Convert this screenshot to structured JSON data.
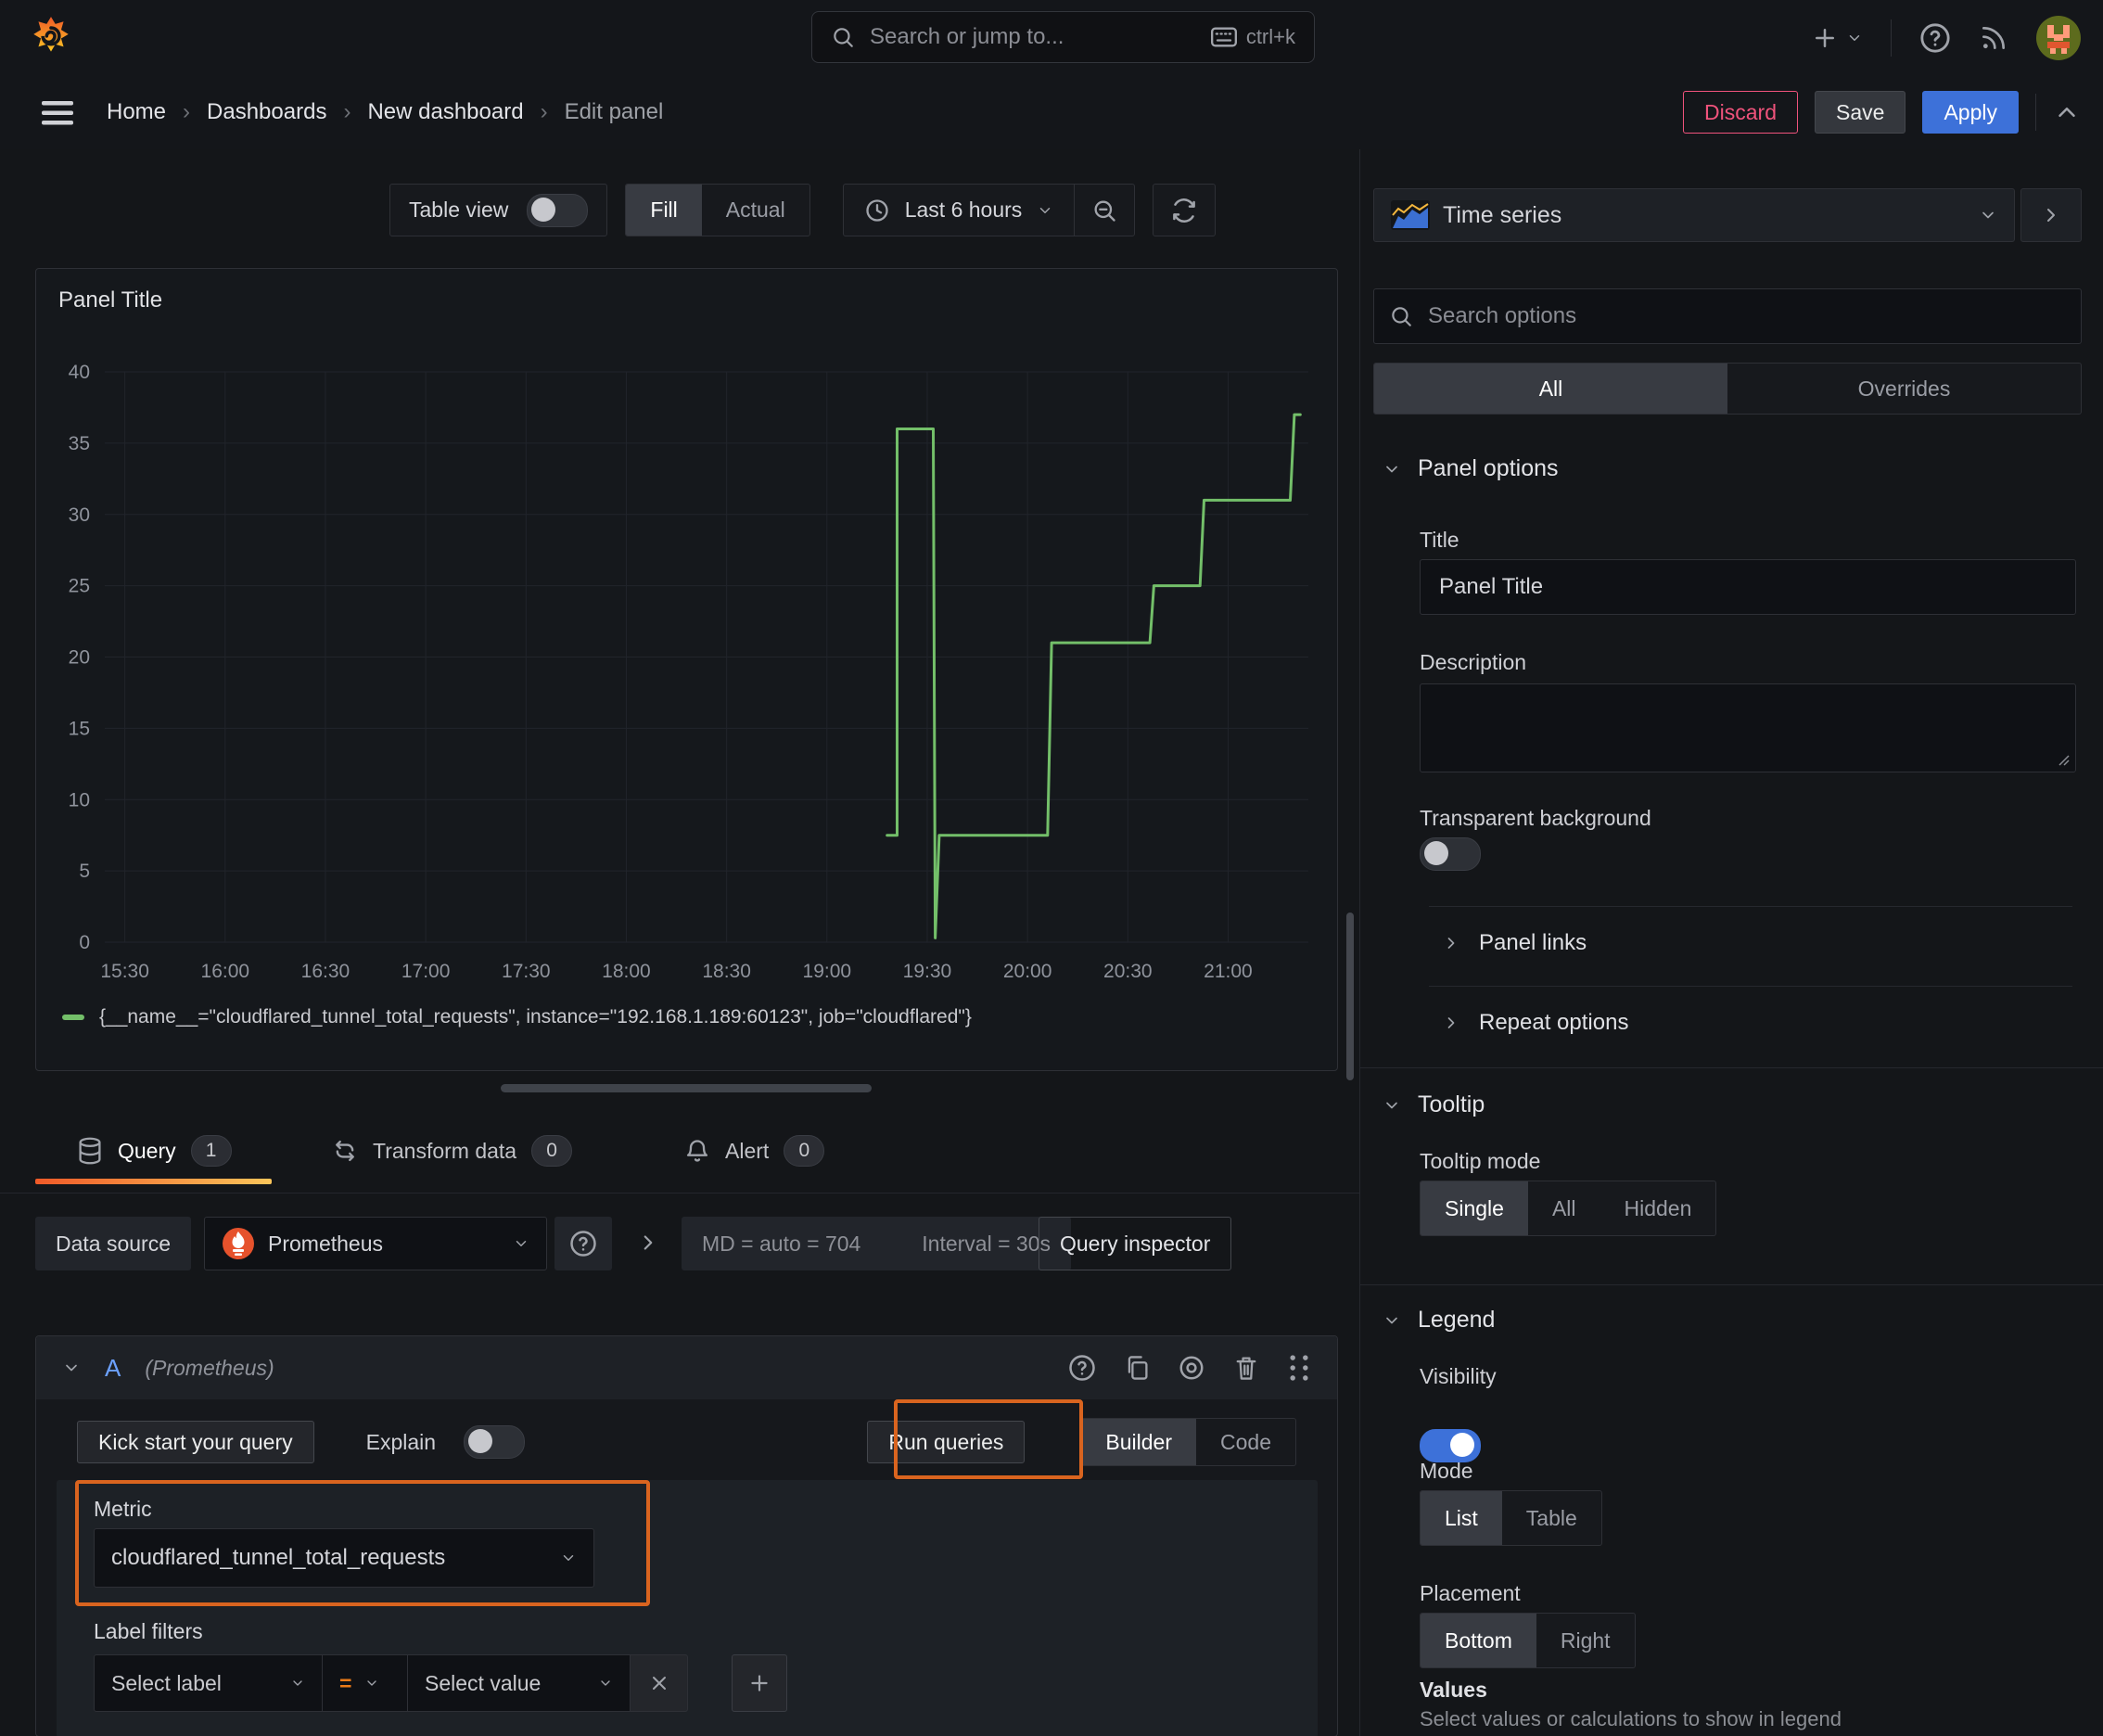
{
  "topbar": {
    "search_placeholder": "Search or jump to...",
    "search_shortcut": "ctrl+k"
  },
  "breadcrumb": {
    "items": [
      "Home",
      "Dashboards",
      "New dashboard",
      "Edit panel"
    ],
    "separator": "›",
    "actions": {
      "discard": "Discard",
      "save": "Save",
      "apply": "Apply"
    }
  },
  "toolbar": {
    "table_view_label": "Table view",
    "fill_label": "Fill",
    "actual_label": "Actual",
    "time_range_label": "Last 6 hours"
  },
  "panel": {
    "title": "Panel Title"
  },
  "chart_data": {
    "type": "line",
    "render": "step",
    "title": "Panel Title",
    "series": [
      {
        "name": "{__name__=\"cloudflared_tunnel_total_requests\", instance=\"192.168.1.189:60123\", job=\"cloudflared\"}",
        "color": "#73bf69"
      }
    ],
    "series_label": "{__name__=\"cloudflared_tunnel_total_requests\", instance=\"192.168.1.189:60123\", job=\"cloudflared\"}",
    "color": "#73bf69",
    "xlabel": "",
    "ylabel": "",
    "ylim": [
      0,
      40
    ],
    "y_ticks": [
      0,
      5,
      10,
      15,
      20,
      25,
      30,
      35,
      40
    ],
    "x_ticks": [
      "15:30",
      "16:00",
      "16:30",
      "17:00",
      "17:30",
      "18:00",
      "18:30",
      "19:00",
      "19:30",
      "20:00",
      "20:30",
      "21:00"
    ],
    "x_tick_hours": [
      15.5,
      16.0,
      16.5,
      17.0,
      17.5,
      18.0,
      18.5,
      19.0,
      19.5,
      20.0,
      20.5,
      21.0
    ],
    "x_range_hours": [
      15.4,
      21.4
    ],
    "grid": true,
    "legend_position": "bottom",
    "points": [
      [
        19.3,
        7.5
      ],
      [
        19.35,
        7.5
      ],
      [
        19.35,
        36
      ],
      [
        19.53,
        36
      ],
      [
        19.54,
        0.3
      ],
      [
        19.56,
        7.5
      ],
      [
        20.1,
        7.5
      ],
      [
        20.12,
        21
      ],
      [
        20.61,
        21
      ],
      [
        20.63,
        25
      ],
      [
        20.86,
        25
      ],
      [
        20.88,
        31
      ],
      [
        21.31,
        31
      ],
      [
        21.33,
        37
      ],
      [
        21.36,
        37
      ]
    ]
  },
  "tabs": {
    "query": {
      "label": "Query",
      "count": 1
    },
    "transform": {
      "label": "Transform data",
      "count": 0
    },
    "alert": {
      "label": "Alert",
      "count": 0
    }
  },
  "ds_row": {
    "label": "Data source",
    "name": "Prometheus",
    "md_info": "MD = auto = 704",
    "interval_info": "Interval = 30s",
    "inspector": "Query inspector"
  },
  "query_editor": {
    "ref": "A",
    "ds_hint": "(Prometheus)",
    "kick_start": "Kick start your query",
    "explain": "Explain",
    "run_queries": "Run queries",
    "builder": "Builder",
    "code": "Code",
    "metric_label": "Metric",
    "metric_value": "cloudflared_tunnel_total_requests",
    "label_filters_label": "Label filters",
    "select_label": "Select label",
    "operator": "=",
    "select_value": "Select value"
  },
  "options": {
    "viz_name": "Time series",
    "search_placeholder": "Search options",
    "tab_all": "All",
    "tab_overrides": "Overrides",
    "panel_options": {
      "header": "Panel options",
      "title_label": "Title",
      "title_value": "Panel Title",
      "description_label": "Description",
      "transparent_label": "Transparent background"
    },
    "panel_links": "Panel links",
    "repeat_options": "Repeat options",
    "tooltip": {
      "header": "Tooltip",
      "mode_label": "Tooltip mode",
      "single": "Single",
      "all": "All",
      "hidden": "Hidden"
    },
    "legend": {
      "header": "Legend",
      "visibility_label": "Visibility",
      "mode_label": "Mode",
      "list": "List",
      "table": "Table",
      "placement_label": "Placement",
      "bottom": "Bottom",
      "right": "Right",
      "values_label": "Values",
      "values_help": "Select values or calculations to show in legend"
    }
  },
  "colors": {
    "accent_orange": "#ff780a",
    "highlight_box": "#d9641f",
    "series_green": "#73bf69",
    "apply_blue": "#3d71d9",
    "discard_pink": "#f0537c"
  }
}
